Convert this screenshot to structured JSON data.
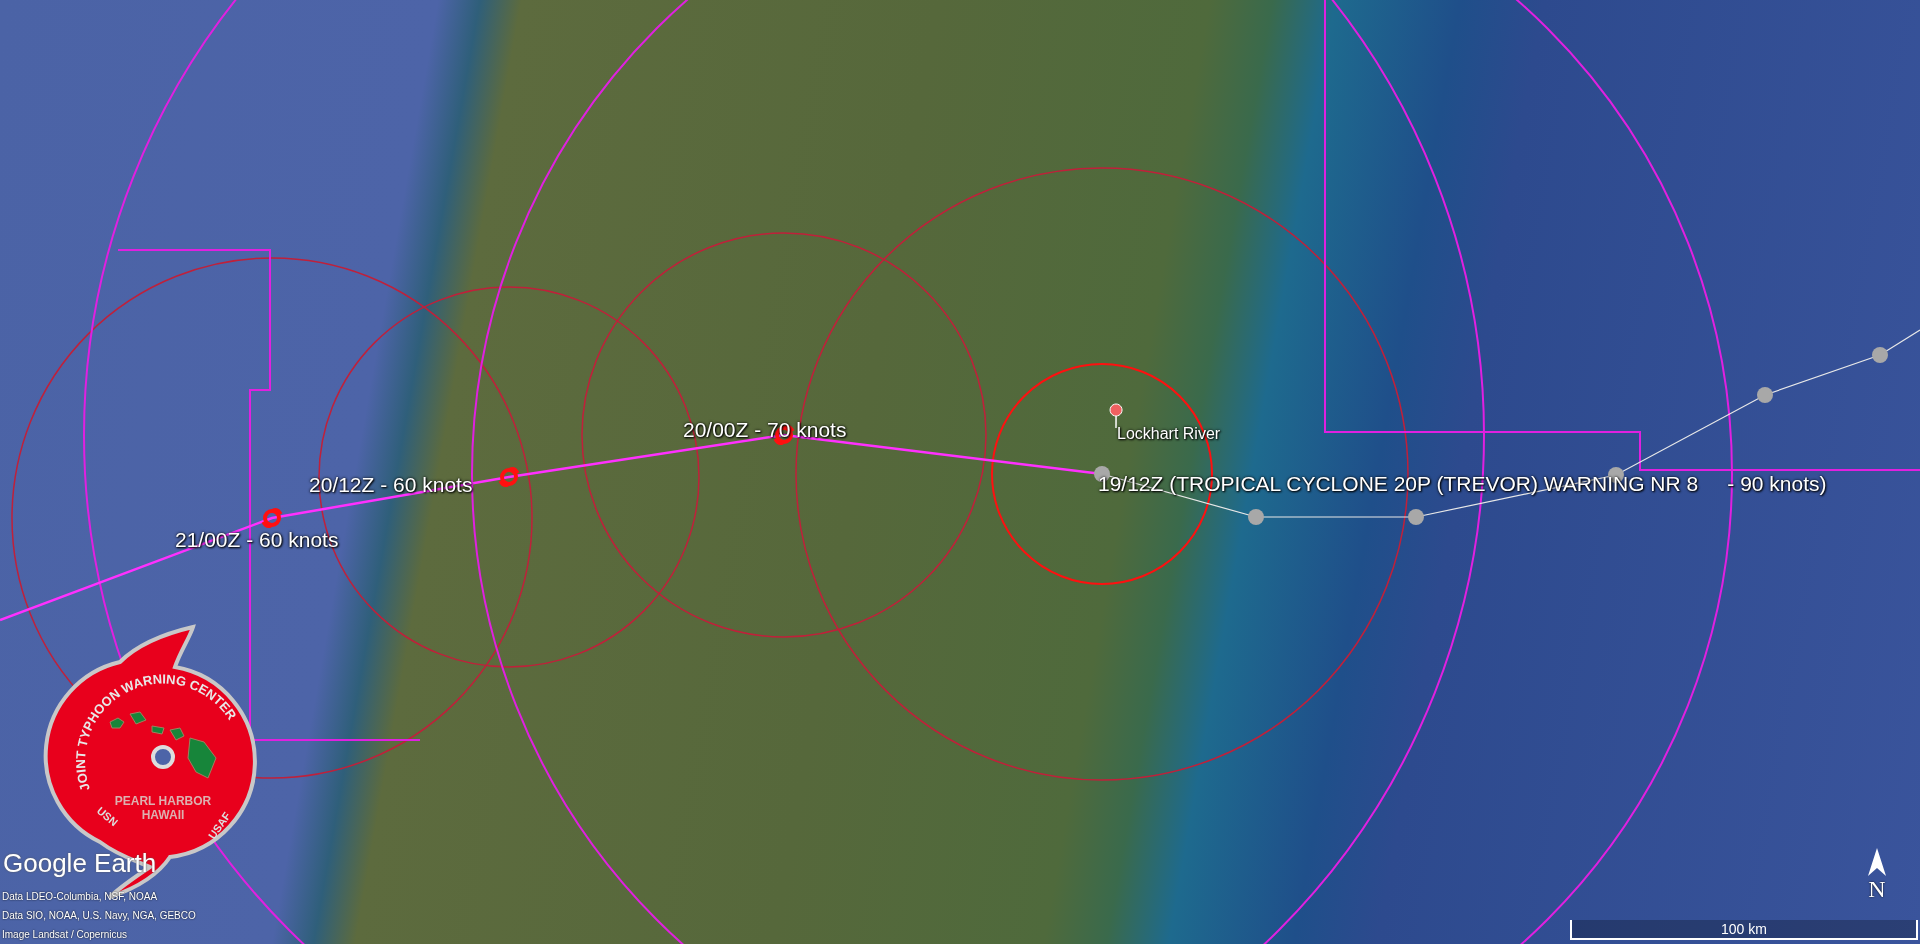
{
  "map": {
    "forecast_labels": [
      {
        "text": "19/12Z (TROPICAL CYCLONE 20P (TREVOR) WARNING NR 8     - 90 knots)"
      },
      {
        "text": "20/00Z - 70 knots"
      },
      {
        "text": "20/12Z - 60 knots"
      },
      {
        "text": "21/00Z - 60 knots"
      }
    ],
    "place_labels": [
      "Lockhart River"
    ]
  },
  "logo": {
    "arc_text": "JOINT TYPHOON WARNING CENTER",
    "line_1": "PEARL HARBOR",
    "line_2": "HAWAII",
    "left_text": "USN",
    "right_text": "USAF"
  },
  "branding": "Google Earth",
  "attribution": [
    "Data LDEO-Columbia, NSF, NOAA",
    "Data SIO, NOAA, U.S. Navy, NGA, GEBCO",
    "Image Landsat / Copernicus"
  ],
  "compass": "N",
  "scale_bar": "100 km"
}
